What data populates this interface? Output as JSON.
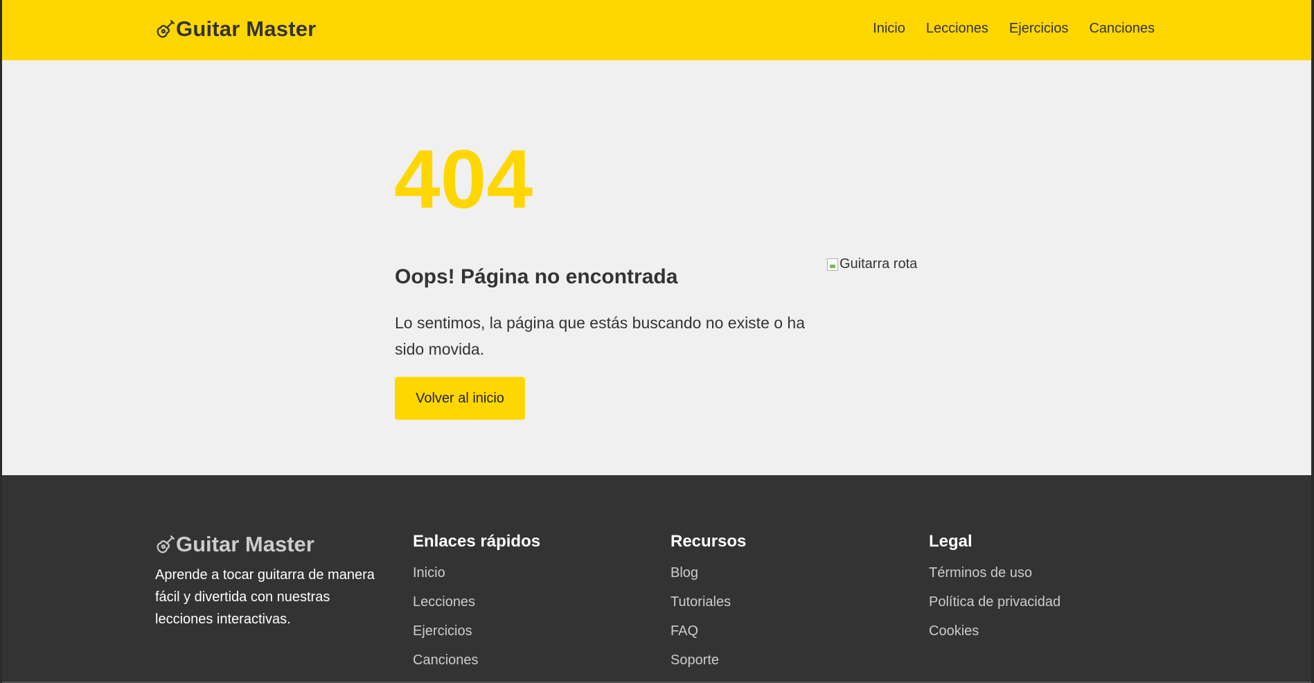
{
  "header": {
    "brand": "Guitar Master",
    "nav": [
      "Inicio",
      "Lecciones",
      "Ejercicios",
      "Canciones"
    ]
  },
  "error": {
    "code": "404",
    "title": "Oops! Página no encontrada",
    "message": "Lo sentimos, la página que estás buscando no existe o ha sido movida.",
    "button_label": "Volver al inicio",
    "image_alt": "Guitarra rota"
  },
  "footer": {
    "brand": "Guitar Master",
    "description": "Aprende a tocar guitarra de manera fácil y divertida con nuestras lecciones interactivas.",
    "columns": [
      {
        "title": "Enlaces rápidos",
        "links": [
          "Inicio",
          "Lecciones",
          "Ejercicios",
          "Canciones"
        ]
      },
      {
        "title": "Recursos",
        "links": [
          "Blog",
          "Tutoriales",
          "FAQ",
          "Soporte"
        ]
      },
      {
        "title": "Legal",
        "links": [
          "Términos de uso",
          "Política de privacidad",
          "Cookies"
        ]
      }
    ]
  },
  "colors": {
    "accent": "#ffd700",
    "text": "#333333",
    "footer_bg": "#333333",
    "page_bg": "#f0f0f0"
  },
  "icons": {
    "brand": "guitar-icon",
    "broken_image": "broken-image-icon"
  }
}
